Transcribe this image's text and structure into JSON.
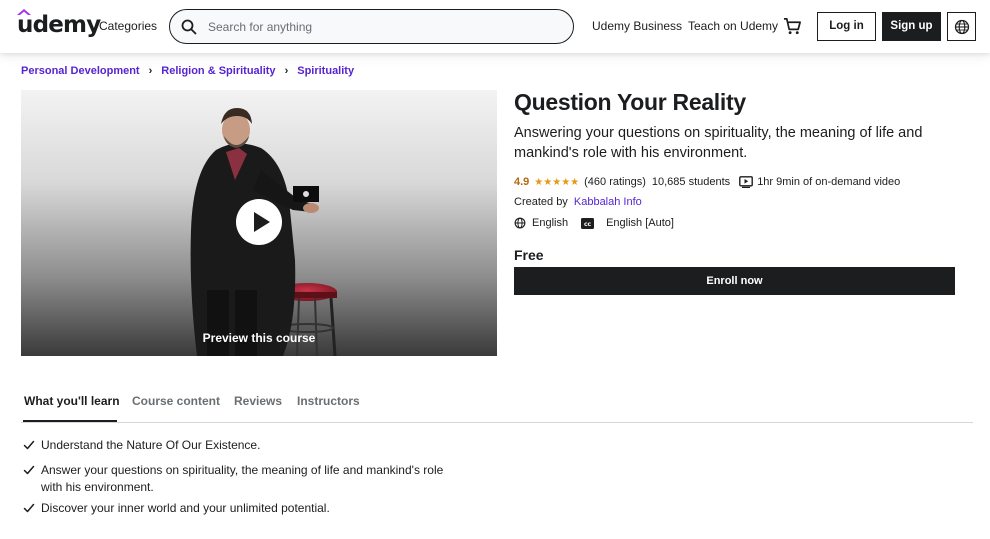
{
  "header": {
    "logo": "udemy",
    "categories": "Categories",
    "search_placeholder": "Search for anything",
    "business_link": "Udemy Business",
    "teach_link": "Teach on Udemy",
    "login": "Log in",
    "signup": "Sign up"
  },
  "breadcrumb": {
    "items": [
      "Personal Development",
      "Religion & Spirituality",
      "Spirituality"
    ]
  },
  "video": {
    "preview_label": "Preview this course"
  },
  "course": {
    "title": "Question Your Reality",
    "subtitle": "Answering your questions on spirituality, the meaning of life and mankind's role with his environment.",
    "rating": "4.9",
    "stars": "★★★★★",
    "ratings_count": "(460 ratings)",
    "students": "10,685 students",
    "duration": "1hr 9min of on-demand video",
    "created_by_label": "Created by",
    "instructor": "Kabbalah Info",
    "language": "English",
    "captions": "English [Auto]",
    "price": "Free",
    "enroll": "Enroll now"
  },
  "tabs": [
    "What you'll learn",
    "Course content",
    "Reviews",
    "Instructors"
  ],
  "learn": [
    "Understand the Nature Of Our Existence.",
    "Answer your questions on spirituality, the meaning of life and mankind's role with his environment.",
    "Discover your inner world and your unlimited potential."
  ],
  "colors": {
    "accent_purple": "#5624d0",
    "rating_orange": "#b4690e",
    "star_gold": "#e59819",
    "dark": "#1c1d1f"
  }
}
